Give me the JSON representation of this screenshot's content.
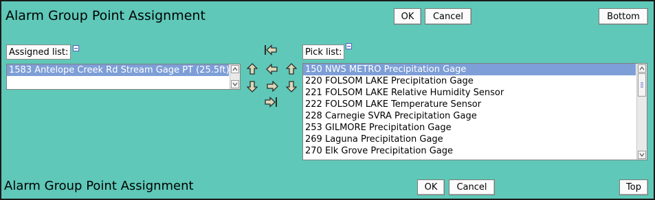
{
  "header": {
    "title": "Alarm Group Point Assignment",
    "ok_label": "OK",
    "cancel_label": "Cancel",
    "bottom_label": "Bottom"
  },
  "assigned": {
    "label": "Assigned list:",
    "items": [
      "1583 Antelope Creek Rd Stream Gage PT (25.5ft)",
      ""
    ]
  },
  "pick": {
    "label": "Pick list:",
    "items": [
      "150 NWS METRO Precipitation Gage",
      "220 FOLSOM LAKE Precipitation Gage",
      "221 FOLSOM LAKE Relative Humidity Sensor",
      "222 FOLSOM LAKE Temperature Sensor",
      "228 Carnegie SVRA Precipitation Gage",
      "253 GILMORE Precipitation Gage",
      "269 Laguna Precipitation Gage",
      "270 Elk Grove Precipitation Gage"
    ]
  },
  "footer": {
    "title": "Alarm Group Point Assignment",
    "ok_label": "OK",
    "cancel_label": "Cancel",
    "top_label": "Top"
  },
  "icons": {
    "move_first": "move-to-first-icon",
    "move_up": "move-up-icon",
    "move_left": "move-left-icon",
    "move_right": "move-right-icon",
    "move_down": "move-down-icon",
    "move_last": "move-to-last-icon",
    "collapse": "collapse-icon"
  },
  "colors": {
    "background": "#5fc8b8",
    "selection": "#7d9ed6"
  }
}
